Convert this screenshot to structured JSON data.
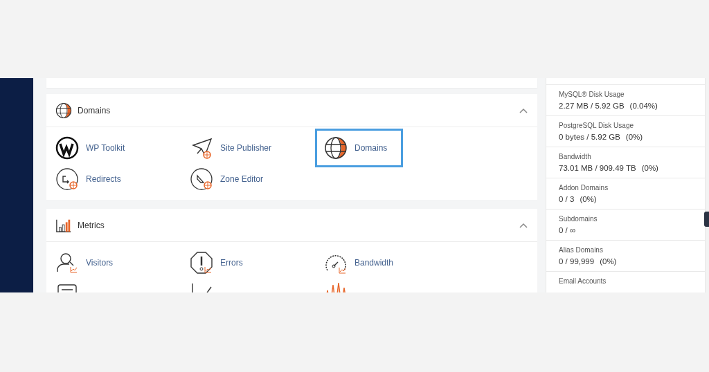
{
  "domains_section": {
    "title": "Domains",
    "expanded": true,
    "items": [
      {
        "kind": "wordpress",
        "label": "WP Toolkit",
        "selected": false
      },
      {
        "kind": "send",
        "label": "Site Publisher",
        "selected": false
      },
      {
        "kind": "globe",
        "label": "Domains",
        "selected": true
      },
      {
        "kind": "redirect",
        "label": "Redirects",
        "selected": false
      },
      {
        "kind": "zone",
        "label": "Zone Editor",
        "selected": false
      }
    ]
  },
  "metrics_section": {
    "title": "Metrics",
    "expanded": true,
    "items": [
      {
        "kind": "visitors",
        "label": "Visitors",
        "selected": false
      },
      {
        "kind": "errors",
        "label": "Errors",
        "selected": false
      },
      {
        "kind": "gauge",
        "label": "Bandwidth",
        "selected": false
      },
      {
        "kind": "list"
      },
      {
        "kind": "trend"
      },
      {
        "kind": "peaks"
      }
    ]
  },
  "stats": [
    {
      "label": "MySQL® Disk Usage",
      "value": "2.27 MB / 5.92 GB",
      "percent": "(0.04%)"
    },
    {
      "label": "PostgreSQL Disk Usage",
      "value": "0 bytes / 5.92 GB",
      "percent": "(0%)"
    },
    {
      "label": "Bandwidth",
      "value": "73.01 MB / 909.49 TB",
      "percent": "(0%)"
    },
    {
      "label": "Addon Domains",
      "value": "0 / 3",
      "percent": "(0%)"
    },
    {
      "label": "Subdomains",
      "value": "0 / ∞"
    },
    {
      "label": "Alias Domains",
      "value": "0 / 99,999",
      "percent": "(0%)"
    },
    {
      "label": "Email Accounts"
    }
  ]
}
